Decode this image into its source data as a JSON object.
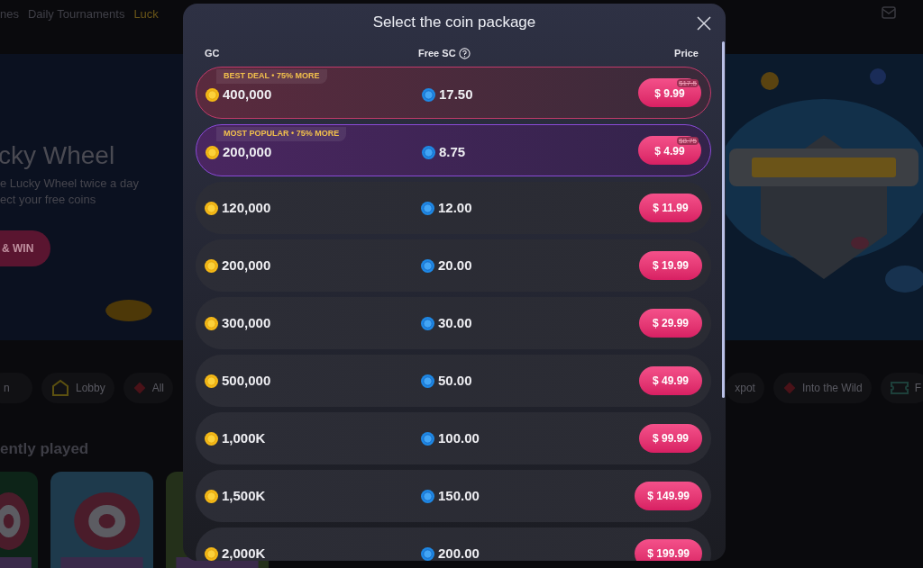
{
  "nav": {
    "items": [
      {
        "label": "nes",
        "selected": false
      },
      {
        "label": "Daily Tournaments",
        "selected": false
      },
      {
        "label": "Luck",
        "selected": true
      }
    ]
  },
  "hero": {
    "title": "cky Wheel",
    "lines": [
      "e Lucky Wheel twice a day",
      "ect your free coins"
    ],
    "button": "& WIN"
  },
  "categories": [
    {
      "label": "n",
      "kind": "plain"
    },
    {
      "label": "Lobby",
      "kind": "house"
    },
    {
      "label": "All",
      "kind": "stack"
    },
    {
      "label": "xpot",
      "kind": "plain"
    },
    {
      "label": "Into the Wild",
      "kind": "stack"
    },
    {
      "label": "F",
      "kind": "ticket"
    }
  ],
  "recent": {
    "title": "ently played"
  },
  "modal": {
    "title": "Select the coin package",
    "columns": [
      "GC",
      "Free SC",
      "Price"
    ],
    "packages": [
      {
        "kind": "best",
        "tag": "BEST DEAL • 75% MORE",
        "gc": "400,000",
        "sc": "17.50",
        "price": "$ 9.99",
        "old_price": "$17.5"
      },
      {
        "kind": "popular",
        "tag": "MOST POPULAR • 75% MORE",
        "gc": "200,000",
        "sc": "8.75",
        "price": "$ 4.99",
        "old_price": "$8.75"
      },
      {
        "kind": "regular",
        "gc": "120,000",
        "sc": "12.00",
        "price": "$ 11.99"
      },
      {
        "kind": "regular",
        "gc": "200,000",
        "sc": "20.00",
        "price": "$ 19.99"
      },
      {
        "kind": "regular",
        "gc": "300,000",
        "sc": "30.00",
        "price": "$ 29.99"
      },
      {
        "kind": "regular",
        "gc": "500,000",
        "sc": "50.00",
        "price": "$ 49.99"
      },
      {
        "kind": "regular",
        "gc": "1,000K",
        "sc": "100.00",
        "price": "$ 99.99"
      },
      {
        "kind": "regular",
        "gc": "1,500K",
        "sc": "150.00",
        "price": "$ 149.99"
      },
      {
        "kind": "regular",
        "gc": "2,000K",
        "sc": "200.00",
        "price": "$ 199.99"
      }
    ]
  }
}
